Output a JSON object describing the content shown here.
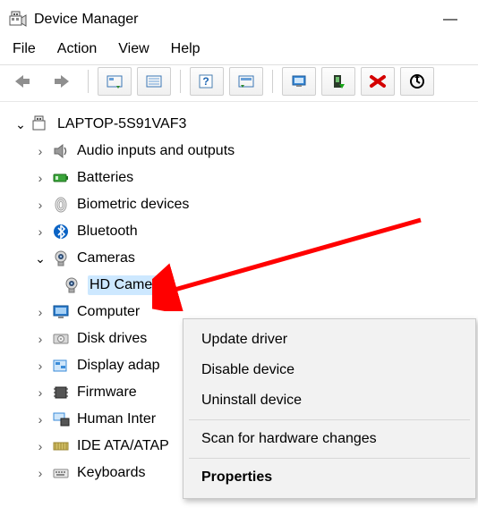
{
  "title": "Device Manager",
  "window_controls": {
    "minimize": "—"
  },
  "menu": {
    "file": "File",
    "action": "Action",
    "view": "View",
    "help": "Help"
  },
  "toolbar": {
    "back": "back-icon",
    "forward": "forward-icon",
    "show_hidden": "show-hidden-icon",
    "details": "details-icon",
    "help": "help-icon",
    "action": "action-icon",
    "show_device": "show-device-icon",
    "scan": "scan-icon",
    "remove": "remove-icon",
    "update": "update-icon"
  },
  "tree": {
    "root": "LAPTOP-5S91VAF3",
    "items": [
      {
        "label": "Audio inputs and outputs",
        "icon": "speaker-icon"
      },
      {
        "label": "Batteries",
        "icon": "battery-icon"
      },
      {
        "label": "Biometric devices",
        "icon": "fingerprint-icon"
      },
      {
        "label": "Bluetooth",
        "icon": "bluetooth-icon"
      },
      {
        "label": "Cameras",
        "icon": "camera-icon",
        "expanded": true,
        "children": [
          {
            "label": "HD Camera",
            "icon": "camera-icon",
            "selected": true
          }
        ]
      },
      {
        "label": "Computer",
        "icon": "monitor-icon"
      },
      {
        "label": "Disk drives",
        "icon": "disk-icon"
      },
      {
        "label": "Display adap",
        "icon": "display-adapter-icon"
      },
      {
        "label": "Firmware",
        "icon": "chip-icon"
      },
      {
        "label": "Human Inter",
        "icon": "hid-icon"
      },
      {
        "label": "IDE ATA/ATAP",
        "icon": "ide-icon"
      },
      {
        "label": "Keyboards",
        "icon": "keyboard-icon"
      }
    ]
  },
  "context_menu": {
    "update": "Update driver",
    "disable": "Disable device",
    "uninstall": "Uninstall device",
    "scan": "Scan for hardware changes",
    "properties": "Properties"
  }
}
